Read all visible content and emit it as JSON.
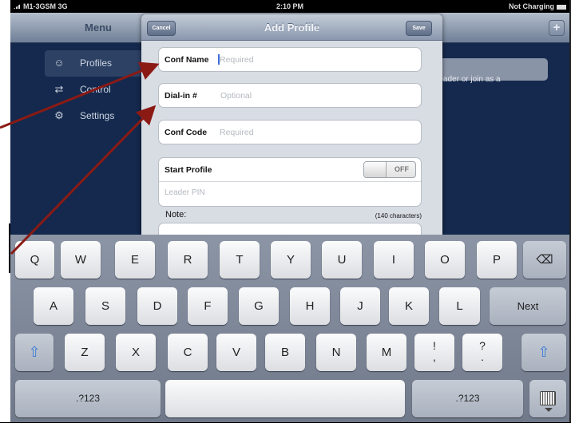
{
  "status_bar": {
    "carrier": "M1-3GSM 3G",
    "time": "2:10 PM",
    "battery": "Not Charging"
  },
  "background": {
    "menu_title": "Menu",
    "plus_label": "+",
    "sidebar": [
      {
        "label": "Profiles",
        "icon": "people-icon",
        "glyph": "☺"
      },
      {
        "label": "Control",
        "icon": "sliders-icon",
        "glyph": "⇄"
      },
      {
        "label": "Settings",
        "icon": "gear-icon",
        "glyph": "⚙"
      }
    ],
    "right_text": "s a leader or join as a"
  },
  "modal": {
    "title": "Add Profile",
    "cancel_label": "Cancel",
    "save_label": "Save",
    "fields": {
      "conf_name": {
        "label": "Conf Name",
        "placeholder": "Required"
      },
      "dial_in": {
        "label": "Dial-in #",
        "placeholder": "Optional"
      },
      "conf_code": {
        "label": "Conf Code",
        "placeholder": "Required"
      }
    },
    "start_profile": {
      "label": "Start Profile",
      "toggle_state": "OFF"
    },
    "leader_pin_placeholder": "Leader PIN",
    "note": {
      "label": "Note:",
      "char_limit": "(140 characters)"
    }
  },
  "keyboard": {
    "row1": [
      "Q",
      "W",
      "E",
      "R",
      "T",
      "Y",
      "U",
      "I",
      "O",
      "P"
    ],
    "row2": [
      "A",
      "S",
      "D",
      "F",
      "G",
      "H",
      "J",
      "K",
      "L"
    ],
    "row3": [
      "Z",
      "X",
      "C",
      "V",
      "B",
      "N",
      "M"
    ],
    "punct1": [
      "!",
      ","
    ],
    "punct2": [
      "?",
      "."
    ],
    "next_label": "Next",
    "numbers_label": ".?123"
  },
  "annotation_color": "#8b1a14"
}
